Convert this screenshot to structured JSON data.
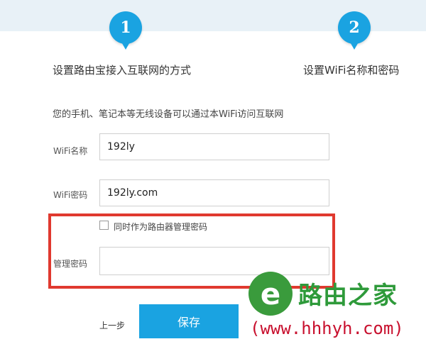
{
  "steps": [
    {
      "number": "1",
      "label": "设置路由宝接入互联网的方式"
    },
    {
      "number": "2",
      "label": "设置WiFi名称和密码"
    }
  ],
  "intro_text": "您的手机、笔记本等无线设备可以通过本WiFi访问互联网",
  "form": {
    "wifi_name": {
      "label": "WiFi名称",
      "value": "192ly"
    },
    "wifi_password": {
      "label": "WiFi密码",
      "value": "192ly.com"
    },
    "same_as_admin": {
      "label": "同时作为路由器管理密码",
      "checked": false
    },
    "admin_password": {
      "label": "管理密码",
      "value": ""
    }
  },
  "actions": {
    "prev_label": "上一步",
    "save_label": "保存"
  },
  "watermark": {
    "logo_letter": "e",
    "title": "路由之家",
    "url": "(www.hhhyh.com)"
  },
  "colors": {
    "accent": "#1aa3e1",
    "highlight": "#e0392f",
    "watermark_green": "#2e9a3a",
    "watermark_red": "#c8102e"
  }
}
